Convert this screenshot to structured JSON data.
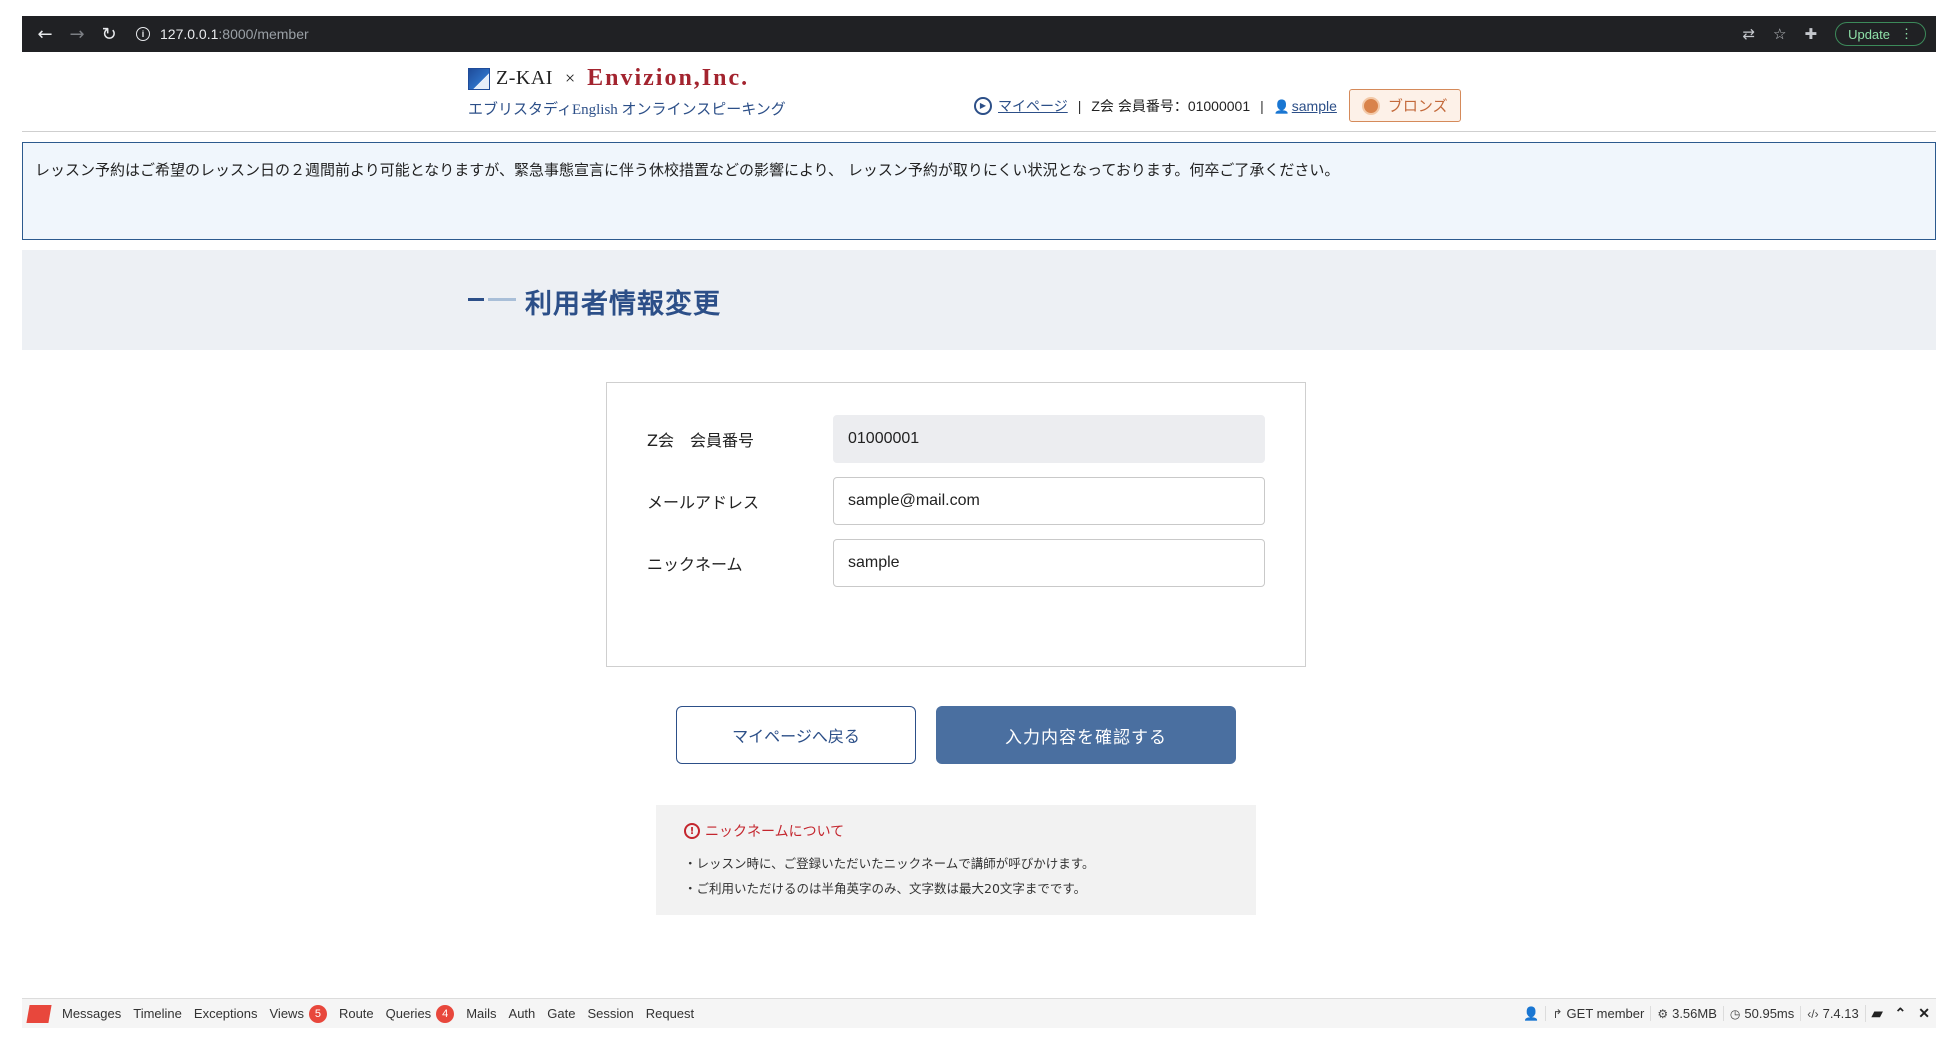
{
  "browser": {
    "url_host": "127.0.0.1",
    "url_path": ":8000/member",
    "update_label": "Update"
  },
  "header": {
    "logo_zkai": "Z-KAI",
    "logo_times": "×",
    "logo_envizion": "Envizion,Inc.",
    "logo_sub": "エブリスタディEnglish オンラインスピーキング",
    "mypage_link": "マイページ",
    "member_info": "Z会 会員番号：01000001",
    "user_link": "sample",
    "rank_badge": "ブロンズ"
  },
  "notice": {
    "text": "レッスン予約はご希望のレッスン日の２週間前より可能となりますが、緊急事態宣言に伴う休校措置などの影響により、 レッスン予約が取りにくい状況となっております。何卒ご了承ください。"
  },
  "page": {
    "title": "利用者情報変更"
  },
  "form": {
    "member_label": "Z会　会員番号",
    "member_value": "01000001",
    "email_label": "メールアドレス",
    "email_value": "sample@mail.com",
    "nickname_label": "ニックネーム",
    "nickname_value": "sample"
  },
  "buttons": {
    "back_label": "マイページへ戻る",
    "confirm_label": "入力内容を確認する"
  },
  "note": {
    "title": "ニックネームについて",
    "line1": "・レッスン時に、ご登録いただいたニックネームで講師が呼びかけます。",
    "line2": "・ご利用いただけるのは半角英字のみ、文字数は最大20文字までです。"
  },
  "debugbar": {
    "tabs": {
      "messages": "Messages",
      "timeline": "Timeline",
      "exceptions": "Exceptions",
      "views": "Views",
      "views_count": "5",
      "route": "Route",
      "queries": "Queries",
      "queries_count": "4",
      "mails": "Mails",
      "auth": "Auth",
      "gate": "Gate",
      "session": "Session",
      "request": "Request"
    },
    "stats": {
      "request": "GET member",
      "memory": "3.56MB",
      "time": "50.95ms",
      "php_version": "7.4.13"
    }
  }
}
